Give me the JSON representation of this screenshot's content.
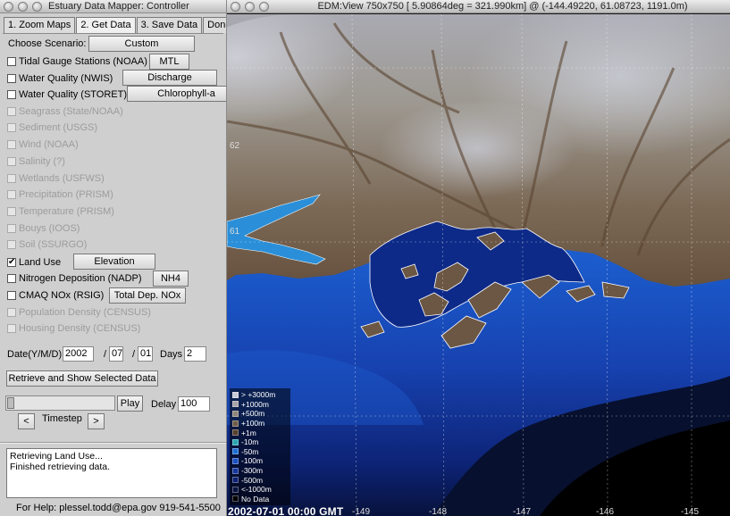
{
  "controller": {
    "title": "Estuary Data Mapper: Controller",
    "tabs": [
      {
        "label": "1. Zoom Maps",
        "active": false
      },
      {
        "label": "2. Get Data",
        "active": true
      },
      {
        "label": "3. Save Data",
        "active": false
      },
      {
        "label": "Done",
        "active": false
      }
    ],
    "scenario": {
      "label": "Choose Scenario:",
      "button": "Custom"
    },
    "datasets": [
      {
        "label": "Tidal Gauge Stations (NOAA)",
        "checked": false,
        "enabled": true,
        "button": "MTL"
      },
      {
        "label": "Water Quality (NWIS)",
        "checked": false,
        "enabled": true,
        "button": "Discharge"
      },
      {
        "label": "Water Quality (STORET)",
        "checked": false,
        "enabled": true,
        "button": "Chlorophyll-a"
      },
      {
        "label": "Seagrass (State/NOAA)",
        "checked": false,
        "enabled": false
      },
      {
        "label": "Sediment (USGS)",
        "checked": false,
        "enabled": false
      },
      {
        "label": "Wind (NOAA)",
        "checked": false,
        "enabled": false
      },
      {
        "label": "Salinity (?)",
        "checked": false,
        "enabled": false
      },
      {
        "label": "Wetlands (USFWS)",
        "checked": false,
        "enabled": false
      },
      {
        "label": "Precipitation (PRISM)",
        "checked": false,
        "enabled": false
      },
      {
        "label": "Temperature (PRISM)",
        "checked": false,
        "enabled": false
      },
      {
        "label": "Bouys (IOOS)",
        "checked": false,
        "enabled": false
      },
      {
        "label": "Soil (SSURGO)",
        "checked": false,
        "enabled": false
      },
      {
        "label": "Land Use",
        "checked": true,
        "enabled": true,
        "button": "Elevation"
      },
      {
        "label": "Nitrogen Deposition (NADP)",
        "checked": false,
        "enabled": true,
        "button": "NH4"
      },
      {
        "label": "CMAQ NOx (RSIG)",
        "checked": false,
        "enabled": true,
        "button": "Total Dep. NOx"
      },
      {
        "label": "Population Density (CENSUS)",
        "checked": false,
        "enabled": false
      },
      {
        "label": "Housing Density (CENSUS)",
        "checked": false,
        "enabled": false
      }
    ],
    "date": {
      "label": "Date(Y/M/D)",
      "year": "2002",
      "sep1": "/",
      "month": "07",
      "sep2": "/",
      "day": "01",
      "days_label": "Days",
      "days": "2"
    },
    "retrieve_button": "Retrieve and Show Selected Data",
    "play_button": "Play",
    "delay_label": "Delay",
    "delay": "100",
    "prev_button": "<",
    "timestep_label": "Timestep",
    "next_button": ">",
    "log_lines": [
      "Retrieving Land Use...",
      "Finished retrieving data."
    ],
    "help_text": "For Help: plessel.todd@epa.gov 919-541-5500",
    "check_mark": "✔"
  },
  "map": {
    "title": "EDM:View 750x750 [ 5.90864deg =  321.990km] @ (-144.49220, 61.08723, 1191.0m)",
    "timestamp": "2002-07-01 00:00 GMT",
    "lat_labels": [
      "62",
      "61"
    ],
    "lon_labels": [
      "-149",
      "-148",
      "-147",
      "-146",
      "-145"
    ],
    "legend": [
      {
        "label": "> +3000m",
        "color": "#c8c8d8"
      },
      {
        "label": "+1000m",
        "color": "#a5a2aa"
      },
      {
        "label": "+500m",
        "color": "#8f8479"
      },
      {
        "label": "+100m",
        "color": "#6f5c48"
      },
      {
        "label": "+1m",
        "color": "#54402d"
      },
      {
        "label": "-10m",
        "color": "#2aa6b0"
      },
      {
        "label": "-50m",
        "color": "#1e6ed0"
      },
      {
        "label": "-100m",
        "color": "#1a4fc0"
      },
      {
        "label": "-300m",
        "color": "#14379a"
      },
      {
        "label": "-500m",
        "color": "#0d2170"
      },
      {
        "label": "<-1000m",
        "color": "#08123e"
      },
      {
        "label": "No Data",
        "color": "#000000"
      }
    ]
  }
}
